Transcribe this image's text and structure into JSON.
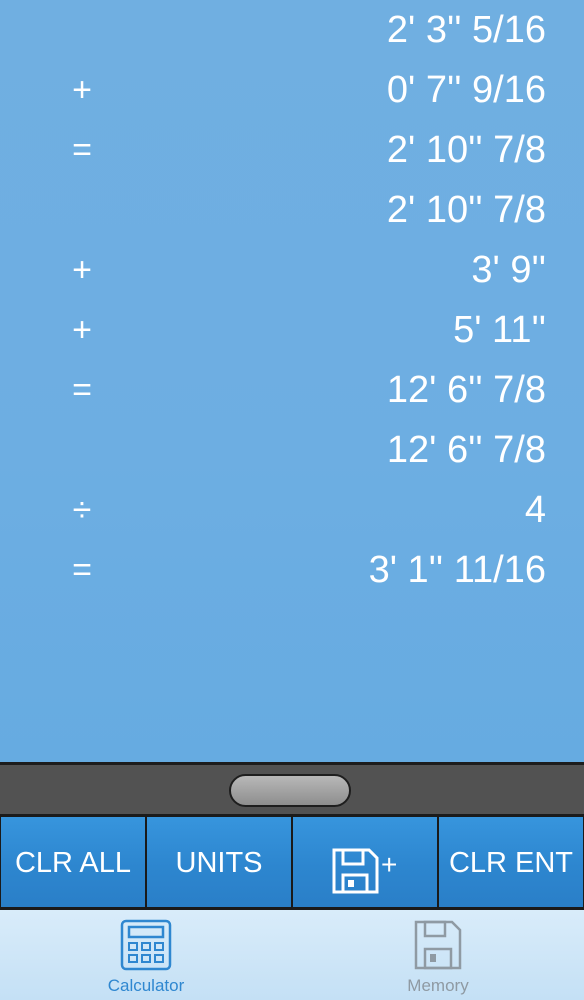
{
  "tape": [
    {
      "op": "",
      "value": "2' 3'' 5/16"
    },
    {
      "op": "+",
      "value": "0' 7'' 9/16"
    },
    {
      "op": "=",
      "value": "2' 10'' 7/8"
    },
    {
      "op": "",
      "value": "2' 10'' 7/8"
    },
    {
      "op": "+",
      "value": "3' 9''"
    },
    {
      "op": "+",
      "value": "5' 11''"
    },
    {
      "op": "=",
      "value": "12' 6'' 7/8"
    },
    {
      "op": "",
      "value": "12' 6'' 7/8"
    },
    {
      "op": "÷",
      "value": "4"
    },
    {
      "op": "=",
      "value": "3' 1'' 11/16"
    }
  ],
  "buttons": {
    "clr_all": "CLR ALL",
    "units": "UNITS",
    "save_plus": "+",
    "clr_ent": "CLR ENT"
  },
  "tabs": {
    "calculator": "Calculator",
    "memory": "Memory"
  },
  "icons": {
    "save_button_icon": "floppy-disk-icon",
    "calculator_tab_icon": "calculator-icon",
    "memory_tab_icon": "floppy-disk-icon"
  },
  "colors": {
    "tape_background": "#6daee2",
    "button_blue": "#2d86cf",
    "tab_active": "#2f87d0",
    "tab_inactive": "#8f9aa3"
  }
}
